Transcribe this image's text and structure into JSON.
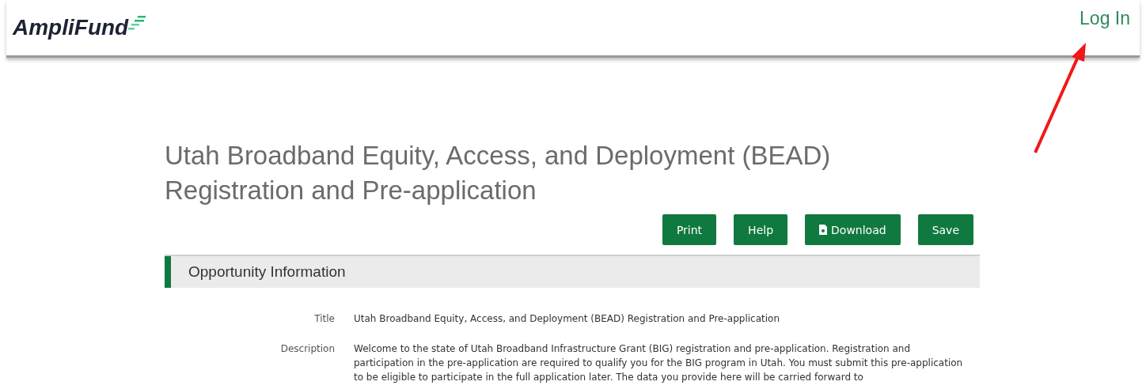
{
  "header": {
    "logo": "AmpliFund",
    "login": "Log In"
  },
  "page": {
    "title": "Utah Broadband Equity, Access, and Deployment (BEAD) Registration and Pre-application"
  },
  "actions": [
    {
      "label": "Print",
      "kind": "plain"
    },
    {
      "label": "Help",
      "kind": "plain"
    },
    {
      "label": "Download",
      "kind": "file"
    },
    {
      "label": "Save",
      "kind": "plain"
    }
  ],
  "section": {
    "heading": "Opportunity Information",
    "fields": [
      {
        "label": "Title",
        "value": "Utah Broadband Equity, Access, and Deployment (BEAD) Registration and Pre-application"
      },
      {
        "label": "Description",
        "value": "Welcome to the state of Utah Broadband Infrastructure Grant (BIG) registration and pre-application. Registration and participation in the pre-application are required to qualify you for the BIG program in Utah. You must submit this pre-application to be eligible to participate in the full application later. The data you provide here will be carried forward to"
      }
    ]
  }
}
